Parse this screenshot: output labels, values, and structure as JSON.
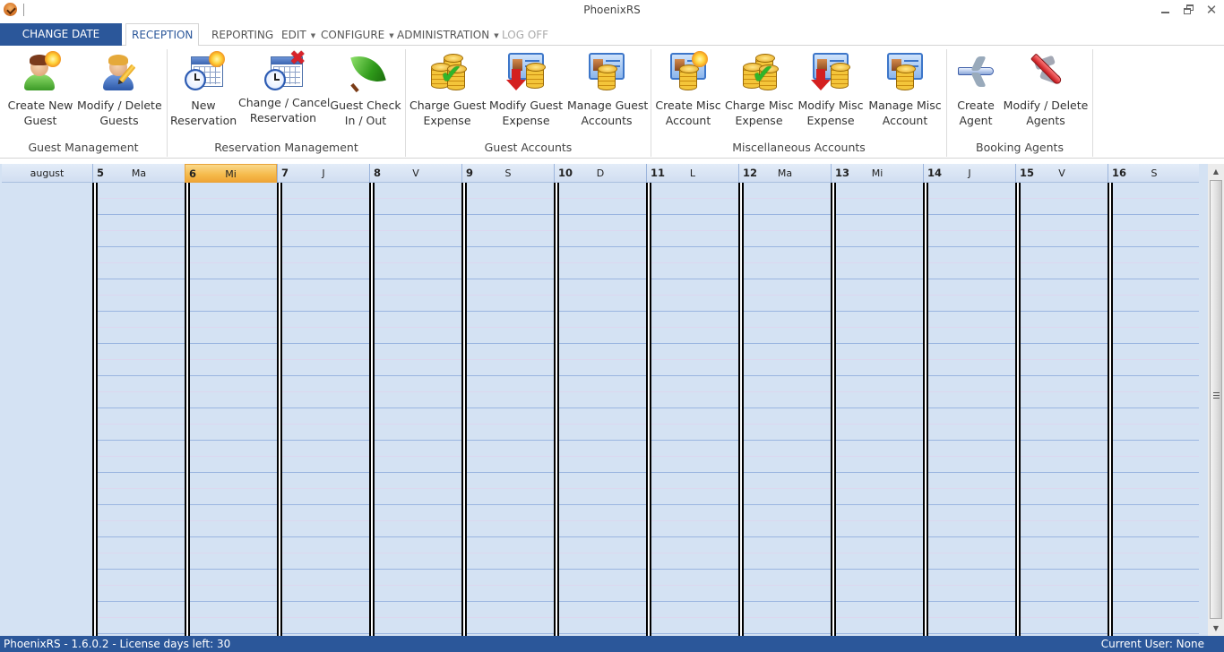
{
  "window": {
    "title": "PhoenixRS",
    "controls": {
      "minimize": "minimize",
      "restore": "restore",
      "close": "✕"
    }
  },
  "menu": {
    "change_date": "CHANGE DATE",
    "tabs": [
      {
        "label": "RECEPTION",
        "active": true,
        "dropdown": false,
        "enabled": true
      },
      {
        "label": "REPORTING",
        "active": false,
        "dropdown": false,
        "enabled": true
      },
      {
        "label": "EDIT",
        "active": false,
        "dropdown": true,
        "enabled": true
      },
      {
        "label": "CONFIGURE",
        "active": false,
        "dropdown": true,
        "enabled": true
      },
      {
        "label": "ADMINISTRATION",
        "active": false,
        "dropdown": true,
        "enabled": true
      },
      {
        "label": "LOG OFF",
        "active": false,
        "dropdown": false,
        "enabled": false
      }
    ],
    "caret": "▼"
  },
  "ribbon": {
    "groups": [
      {
        "label": "Guest Management",
        "buttons": [
          {
            "line1": "Create New",
            "line2": "Guest",
            "icon": "create-guest-icon"
          },
          {
            "line1": "Modify / Delete",
            "line2": "Guests",
            "icon": "modify-guest-icon"
          }
        ]
      },
      {
        "label": "Reservation Management",
        "buttons": [
          {
            "line1": "New",
            "line2": "Reservation",
            "icon": "new-reservation-icon"
          },
          {
            "line1": "Change / Cancel",
            "line2": "Reservation",
            "icon": "cancel-reservation-icon"
          },
          {
            "line1": "Guest Check",
            "line2": "In / Out",
            "icon": "check-in-out-icon"
          }
        ]
      },
      {
        "label": "Guest Accounts",
        "buttons": [
          {
            "line1": "Charge Guest",
            "line2": "Expense",
            "icon": "charge-expense-icon"
          },
          {
            "line1": "Modify Guest",
            "line2": "Expense",
            "icon": "modify-expense-icon"
          },
          {
            "line1": "Manage Guest",
            "line2": "Accounts",
            "icon": "manage-accounts-icon"
          }
        ]
      },
      {
        "label": "Miscellaneous Accounts",
        "buttons": [
          {
            "line1": "Create Misc",
            "line2": "Account",
            "icon": "create-account-icon"
          },
          {
            "line1": "Charge Misc",
            "line2": "Expense",
            "icon": "charge-expense-icon"
          },
          {
            "line1": "Modify Misc",
            "line2": "Expense",
            "icon": "modify-expense-icon"
          },
          {
            "line1": "Manage Misc",
            "line2": "Account",
            "icon": "manage-accounts-icon"
          }
        ]
      },
      {
        "label": "Booking Agents",
        "buttons": [
          {
            "line1": "Create",
            "line2": "Agent",
            "icon": "create-agent-icon"
          },
          {
            "line1": "Modify / Delete",
            "line2": "Agents",
            "icon": "modify-agent-icon"
          }
        ]
      }
    ]
  },
  "scheduler": {
    "month": "august",
    "days": [
      {
        "num": "5",
        "weekday": "Ma",
        "today": false
      },
      {
        "num": "6",
        "weekday": "Mi",
        "today": true
      },
      {
        "num": "7",
        "weekday": "J",
        "today": false
      },
      {
        "num": "8",
        "weekday": "V",
        "today": false
      },
      {
        "num": "9",
        "weekday": "S",
        "today": false
      },
      {
        "num": "10",
        "weekday": "D",
        "today": false
      },
      {
        "num": "11",
        "weekday": "L",
        "today": false
      },
      {
        "num": "12",
        "weekday": "Ma",
        "today": false
      },
      {
        "num": "13",
        "weekday": "Mi",
        "today": false
      },
      {
        "num": "14",
        "weekday": "J",
        "today": false
      },
      {
        "num": "15",
        "weekday": "V",
        "today": false
      },
      {
        "num": "16",
        "weekday": "S",
        "today": false
      }
    ]
  },
  "scrollbar": {
    "up": "▲",
    "down": "▼"
  },
  "status": {
    "left": "PhoenixRS - 1.6.0.2 - License days left: 30",
    "right": "Current User: None"
  },
  "colors": {
    "accent": "#2b579a",
    "today_highlight": "#f5b94a",
    "grid_bg": "#d4e2f3"
  }
}
